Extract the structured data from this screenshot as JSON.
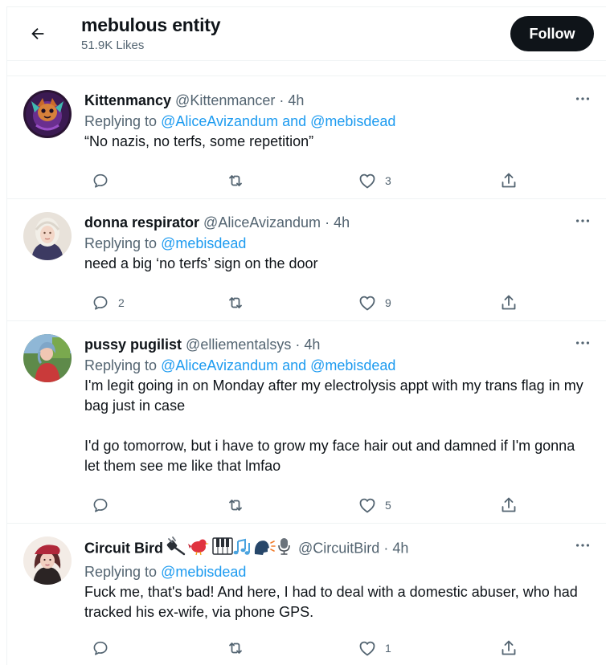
{
  "header": {
    "title": "mebulous entity",
    "subtitle": "51.9K Likes",
    "follow_label": "Follow"
  },
  "tweets": [
    {
      "name": "Kittenmancy",
      "handle": "@Kittenmancer",
      "time": "· 4h",
      "replying_prefix": "Replying to",
      "replying_targets": "@AliceAvizandum and @mebisdead",
      "text": "“No nazis, no terfs, some repetition”",
      "replies": "",
      "retweets": "",
      "likes": "3"
    },
    {
      "name": "donna respirator",
      "handle": "@AliceAvizandum",
      "time": "· 4h",
      "replying_prefix": "Replying to",
      "replying_targets": "@mebisdead",
      "text": "need a big ‘no terfs’ sign on the door",
      "replies": "2",
      "retweets": "",
      "likes": "9"
    },
    {
      "name": "pussy pugilist",
      "handle": "@elliementalsys",
      "time": "· 4h",
      "replying_prefix": "Replying to",
      "replying_targets": "@AliceAvizandum and @mebisdead",
      "text": "I'm legit going in on Monday after my electrolysis appt with my trans flag in my bag just in case\n\nI'd go tomorrow, but i have to grow my face hair out and damned if I'm gonna let them see me like that lmfao",
      "replies": "",
      "retweets": "",
      "likes": "5"
    },
    {
      "name": "Circuit Bird",
      "name_emoji": "🔌🐦🎹🎶🗣🎙",
      "handle": "@CircuitBird",
      "time": "· 4h",
      "replying_prefix": "Replying to",
      "replying_targets": "@mebisdead",
      "text": "Fuck me, that's bad! And here, I had to deal with a domestic abuser, who had tracked his ex-wife, via phone GPS.",
      "replies": "",
      "retweets": "",
      "likes": "1"
    }
  ],
  "icons": {
    "back": "arrow-left-icon",
    "more": "more-horizontal-icon",
    "reply": "reply-icon",
    "retweet": "retweet-icon",
    "like": "heart-icon",
    "share": "share-icon"
  },
  "colors": {
    "link": "#1d9bf0",
    "muted": "#536471",
    "text": "#0f1419",
    "follow_bg": "#0f1419"
  }
}
